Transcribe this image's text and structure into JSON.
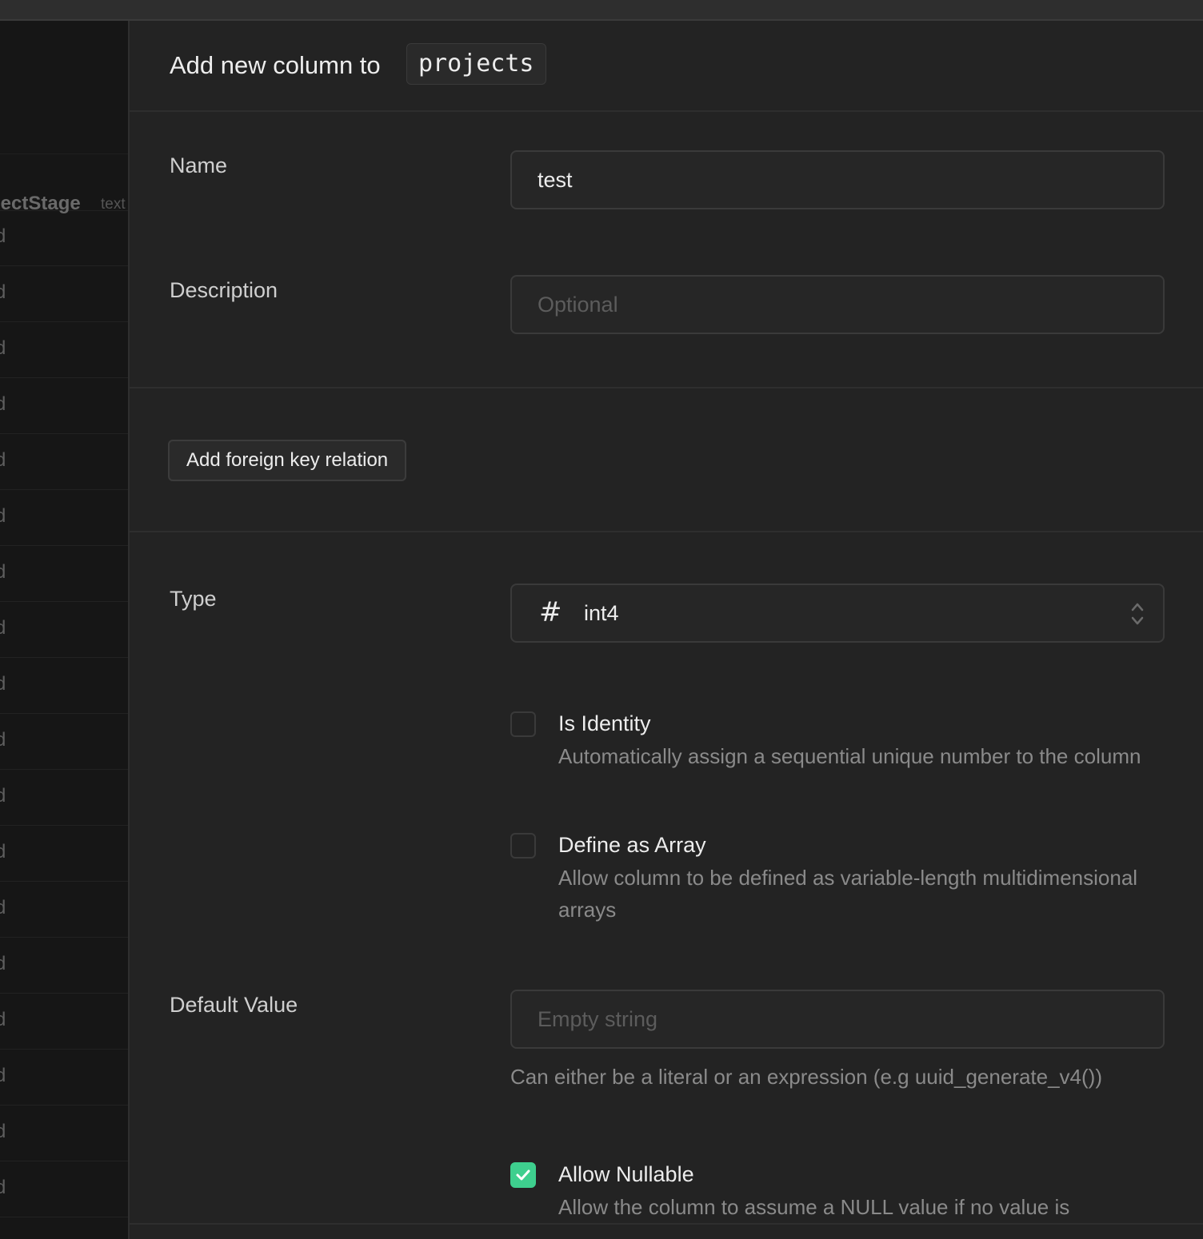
{
  "panel": {
    "title": "Add new column to",
    "table_name": "projects"
  },
  "background_table": {
    "column_name": "jectStage",
    "column_type": "text",
    "row_char": "d",
    "row_count": 18
  },
  "form": {
    "name": {
      "label": "Name",
      "value": "test"
    },
    "description": {
      "label": "Description",
      "placeholder": "Optional"
    },
    "foreign_key_button": "Add foreign key relation",
    "type": {
      "label": "Type",
      "icon": "hash-icon",
      "value": "int4"
    },
    "is_identity": {
      "title": "Is Identity",
      "description": "Automatically assign a sequential unique number to the column",
      "checked": false
    },
    "define_array": {
      "title": "Define as Array",
      "description": "Allow column to be defined as variable-length multidimensional arrays",
      "checked": false
    },
    "default_value": {
      "label": "Default Value",
      "placeholder": "Empty string",
      "hint": "Can either be a literal or an expression (e.g uuid_generate_v4())"
    },
    "allow_nullable": {
      "title": "Allow Nullable",
      "description": "Allow the column to assume a NULL value if no value is",
      "checked": true
    }
  },
  "colors": {
    "accent": "#3ecf8e"
  }
}
